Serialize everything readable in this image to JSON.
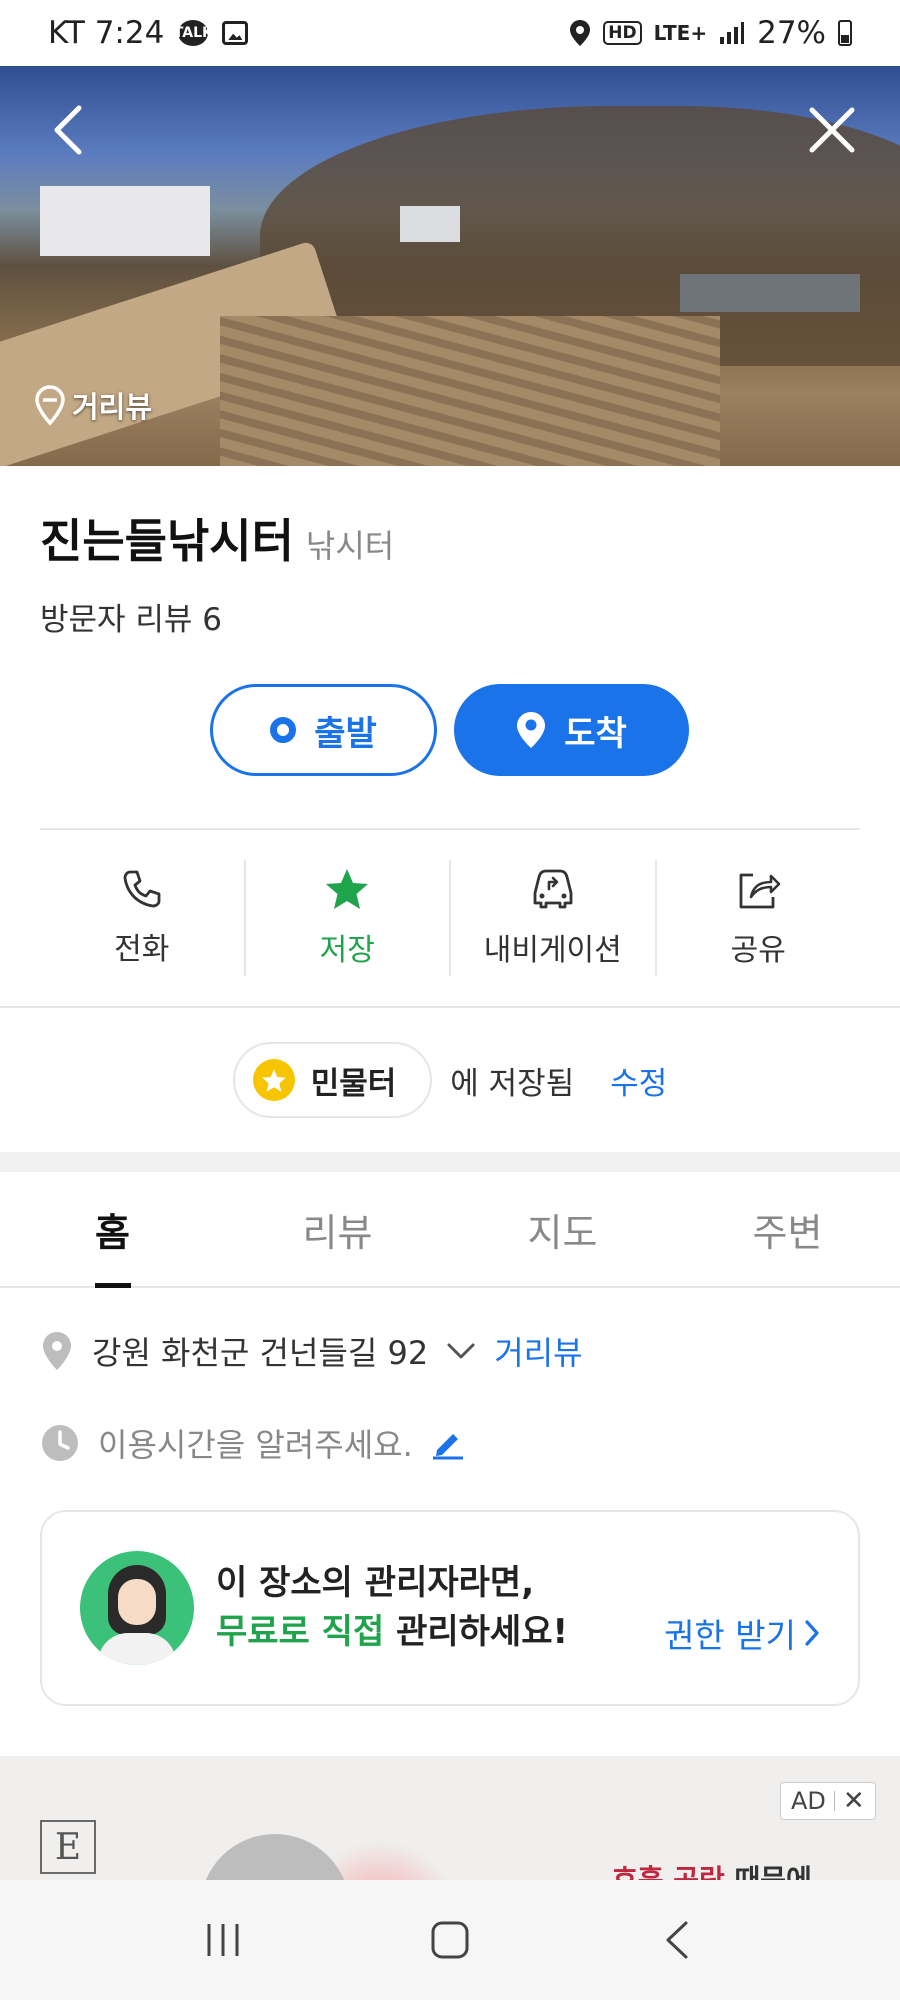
{
  "status_bar": {
    "carrier_time": "KT 7:24",
    "talk_badge": "TALK",
    "hd": "HD",
    "lte": "LTE+",
    "battery": "27%"
  },
  "hero": {
    "street_view_label": "거리뷰"
  },
  "place": {
    "name": "진는들낚시터",
    "category": "낚시터",
    "reviews": "방문자 리뷰 6"
  },
  "route": {
    "start_label": "출발",
    "arrive_label": "도착"
  },
  "actions": [
    {
      "label": "전화"
    },
    {
      "label": "저장"
    },
    {
      "label": "내비게이션"
    },
    {
      "label": "공유"
    }
  ],
  "saved": {
    "folder": "민물터",
    "text": "에 저장됨",
    "edit": "수정"
  },
  "tabs": [
    {
      "label": "홈",
      "active": true
    },
    {
      "label": "리뷰"
    },
    {
      "label": "지도"
    },
    {
      "label": "주변"
    }
  ],
  "info": {
    "address": "강원 화천군 건넌들길 92",
    "street_view_link": "거리뷰",
    "hours_hint": "이용시간을 알려주세요."
  },
  "owner_card": {
    "line1": "이 장소의 관리자라면,",
    "line2_green": "무료로 직접",
    "line2_rest": " 관리하세요!",
    "link": "권한 받기"
  },
  "ad": {
    "badge": "AD",
    "logo_letter": "E",
    "text_red": "호흡 곤란",
    "text_rest": " 때문에"
  },
  "colors": {
    "primary_blue": "#1a73e8",
    "save_green": "#1fa34b",
    "star_yellow": "#f7c500"
  }
}
